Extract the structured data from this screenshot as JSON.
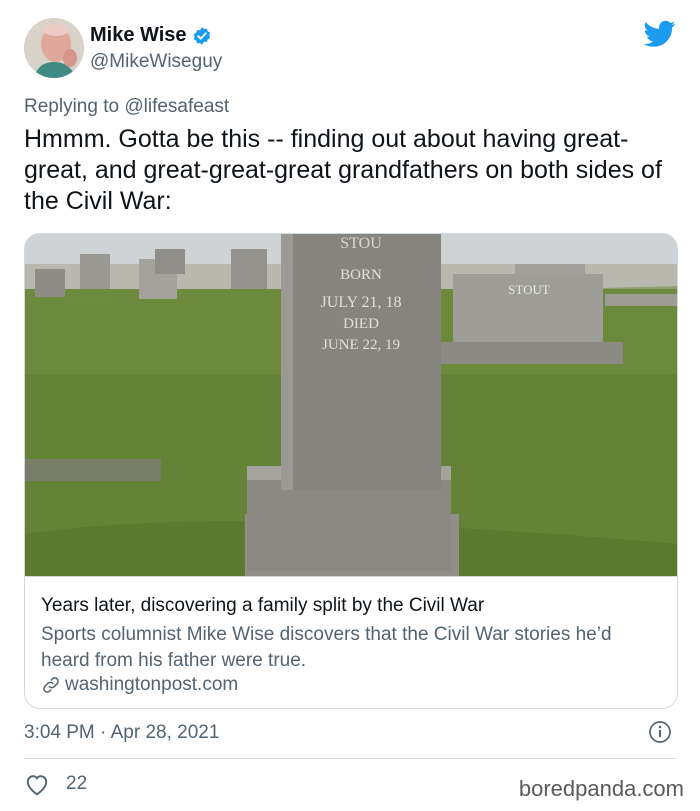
{
  "user": {
    "name": "Mike Wise",
    "handle": "@MikeWiseguy"
  },
  "reply": {
    "prefix": "Replying to",
    "mention": "@lifesafeast"
  },
  "tweet_text": "Hmmm. Gotta be this -- finding out about having great-great, and great-great-great grandfathers on both sides of the Civil War:",
  "card": {
    "headstone_upper": "STOU",
    "headstone_inscription": [
      "BORN",
      "JULY 21, 18",
      "DIED",
      "JUNE 22, 19"
    ],
    "background_stone_name": "STOUT",
    "title": "Years later, discovering a family split by the Civil War",
    "description": "Sports columnist Mike Wise discovers that the Civil War stories he’d heard from his father were true.",
    "domain": "washingtonpost.com"
  },
  "meta": {
    "time": "3:04 PM",
    "separator": " · ",
    "date": "Apr 28, 2021"
  },
  "likes": "22",
  "watermark": "boredpanda.com",
  "colors": {
    "verified": "#1d9bf0",
    "twitter_blue": "#1d9bf0",
    "secondary_text": "#536471"
  },
  "icons": [
    "verified-badge-icon",
    "twitter-bird-icon",
    "link-icon",
    "info-icon",
    "heart-icon"
  ]
}
